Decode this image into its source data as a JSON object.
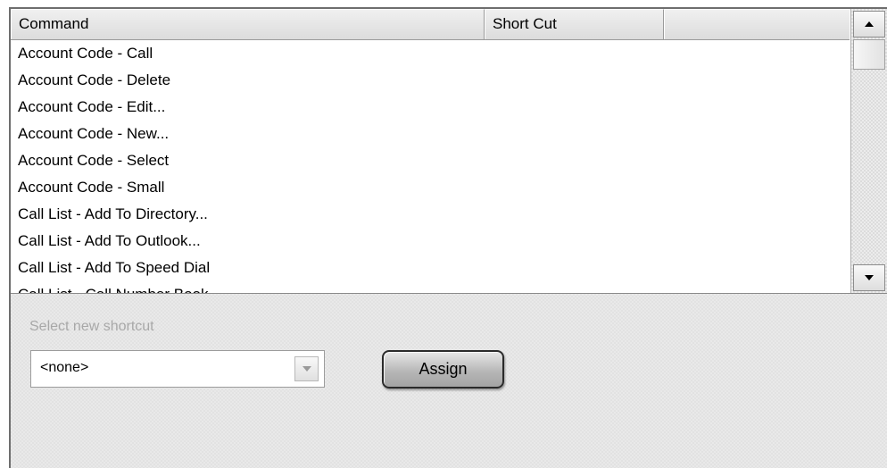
{
  "table": {
    "columns": [
      "Command",
      "Short Cut",
      ""
    ],
    "rows": [
      "Account Code - Call",
      "Account Code - Delete",
      "Account Code - Edit...",
      "Account Code - New...",
      "Account Code - Select",
      "Account Code - Small",
      "Call List - Add To Directory...",
      "Call List - Add To Outlook...",
      "Call List - Add To Speed Dial",
      "Call List - Call Number Book..."
    ]
  },
  "scrollbar": {
    "up_icon": "arrow-up-icon",
    "down_icon": "arrow-down-icon"
  },
  "shortcut": {
    "label": "Select new shortcut",
    "selected": "<none>",
    "assign_label": "Assign"
  }
}
